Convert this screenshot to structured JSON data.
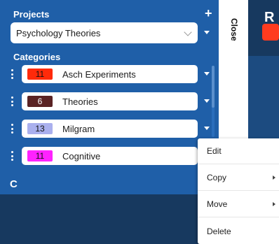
{
  "sidebar": {
    "projects_title": "Projects",
    "add_icon": "+",
    "project_select": {
      "value": "Psychology Theories"
    },
    "categories_title": "Categories",
    "refresh_icon": "C",
    "categories": [
      {
        "count": "11",
        "label": "Asch Experiments",
        "color": "#ff2a0a",
        "text_color": "#111111"
      },
      {
        "count": "6",
        "label": "Theories",
        "color": "#5a2324",
        "text_color": "#ffffff"
      },
      {
        "count": "13",
        "label": "Milgram",
        "color": "#aab0ee",
        "text_color": "#111111"
      },
      {
        "count": "11",
        "label": "Cognitive",
        "color": "#ff22ff",
        "text_color": "#111111"
      }
    ]
  },
  "close_tab": {
    "label": "Close"
  },
  "right_panel": {
    "title_fragment": "R",
    "accent": "#ff3b1f"
  },
  "context_menu": {
    "items": [
      {
        "label": "Edit",
        "has_submenu": false
      },
      {
        "label": "Copy",
        "has_submenu": true
      },
      {
        "label": "Move",
        "has_submenu": true
      },
      {
        "label": "Delete",
        "has_submenu": false
      }
    ]
  },
  "colors": {
    "panel": "#1f5fa8",
    "dark": "#17395f"
  }
}
